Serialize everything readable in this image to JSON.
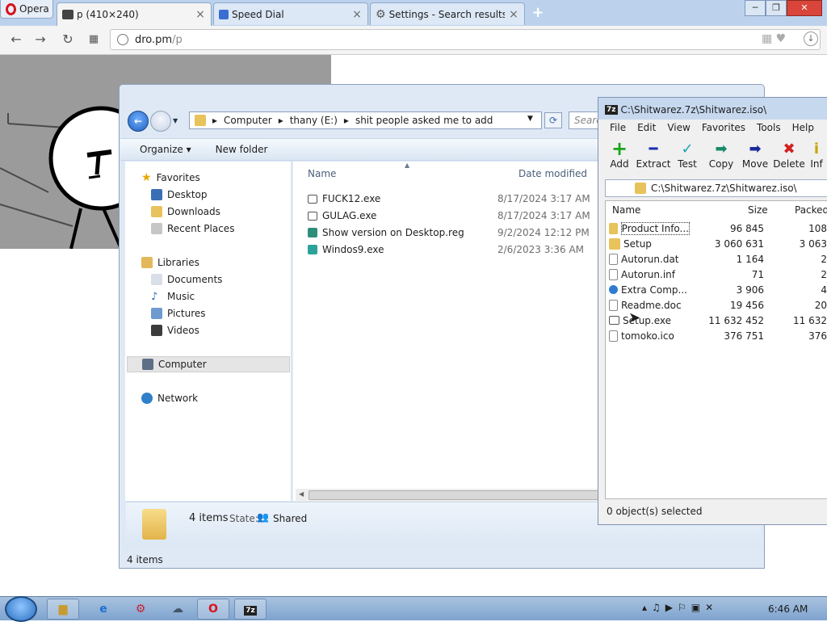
{
  "browser": {
    "app_name": "Opera",
    "tabs": [
      {
        "label": "p (410×240)",
        "active": true
      },
      {
        "label": "Speed Dial",
        "active": false
      },
      {
        "label": "Settings - Search results",
        "active": false
      }
    ],
    "new_tab_label": "+",
    "url_host": "dro.pm",
    "url_path": "/p"
  },
  "explorer": {
    "breadcrumb": [
      "Computer",
      "thany (E:)",
      "shit people asked me to add"
    ],
    "search_placeholder": "Search",
    "toolbar": {
      "organize": "Organize ▾",
      "new_folder": "New folder"
    },
    "nav": {
      "favorites": "Favorites",
      "fav_items": [
        "Desktop",
        "Downloads",
        "Recent Places"
      ],
      "libraries": "Libraries",
      "lib_items": [
        "Documents",
        "Music",
        "Pictures",
        "Videos"
      ],
      "computer": "Computer",
      "network": "Network"
    },
    "columns": {
      "name": "Name",
      "date": "Date modified"
    },
    "files": [
      {
        "name": "FUCK12.exe",
        "date": "8/17/2024 3:17 AM"
      },
      {
        "name": "GULAG.exe",
        "date": "8/17/2024 3:17 AM"
      },
      {
        "name": "Show version on Desktop.reg",
        "date": "9/2/2024 12:12 PM"
      },
      {
        "name": "Windos9.exe",
        "date": "2/6/2023 3:36 AM"
      }
    ],
    "details": {
      "count": "4 items",
      "state_label": "State:",
      "state_value": "Shared"
    },
    "status": "4 items"
  },
  "sevenzip": {
    "title": "C:\\Shitwarez.7z\\Shitwarez.iso\\",
    "menu": [
      "File",
      "Edit",
      "View",
      "Favorites",
      "Tools",
      "Help"
    ],
    "toolbar": [
      {
        "label": "Add",
        "glyph": "+",
        "color": "#1aa51a"
      },
      {
        "label": "Extract",
        "glyph": "━",
        "color": "#1a2fb5"
      },
      {
        "label": "Test",
        "glyph": "✓",
        "color": "#17a3b8"
      },
      {
        "label": "Copy",
        "glyph": "➡",
        "color": "#178a6a"
      },
      {
        "label": "Move",
        "glyph": "➡",
        "color": "#1a2a9a"
      },
      {
        "label": "Delete",
        "glyph": "✖",
        "color": "#d21f1f"
      },
      {
        "label": "Inf",
        "glyph": "i",
        "color": "#c9a300"
      }
    ],
    "path": "C:\\Shitwarez.7z\\Shitwarez.iso\\",
    "columns": {
      "name": "Name",
      "size": "Size",
      "packed": "Packed"
    },
    "rows": [
      {
        "name": "Product Info...",
        "size": "96 845",
        "packed": "108",
        "icon": "folder"
      },
      {
        "name": "Setup",
        "size": "3 060 631",
        "packed": "3 063",
        "icon": "folder"
      },
      {
        "name": "Autorun.dat",
        "size": "1 164",
        "packed": "2",
        "icon": "file"
      },
      {
        "name": "Autorun.inf",
        "size": "71",
        "packed": "2",
        "icon": "file"
      },
      {
        "name": "Extra Comp...",
        "size": "3 906",
        "packed": "4",
        "icon": "file"
      },
      {
        "name": "Readme.doc",
        "size": "19 456",
        "packed": "20",
        "icon": "file"
      },
      {
        "name": "Setup.exe",
        "size": "11 632 452",
        "packed": "11 632",
        "icon": "file"
      },
      {
        "name": "tomoko.ico",
        "size": "376 751",
        "packed": "376",
        "icon": "file"
      }
    ],
    "status": "0 object(s) selected"
  },
  "taskbar": {
    "clock": "6:46 AM",
    "items": [
      "explorer",
      "ie",
      "app3",
      "app4",
      "opera",
      "7z"
    ]
  }
}
